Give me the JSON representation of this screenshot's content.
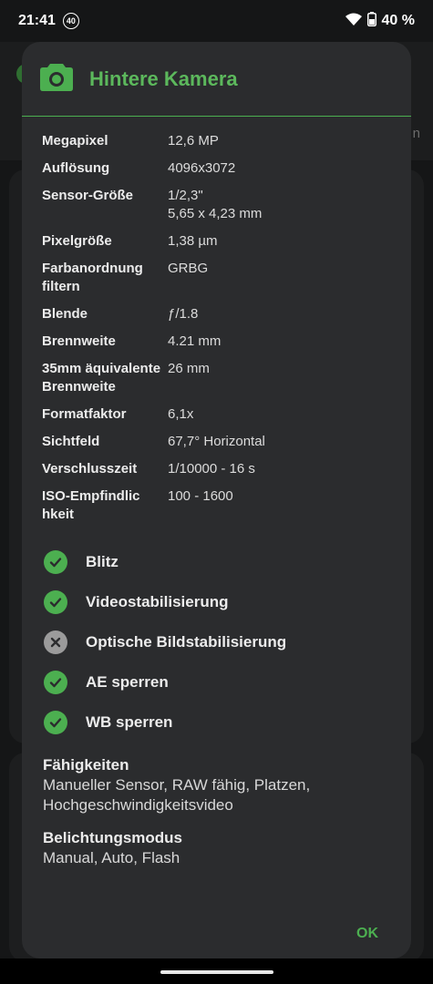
{
  "status_bar": {
    "time": "21:41",
    "notification_badge": "40",
    "battery": "40 %"
  },
  "background": {
    "tab_text": "n"
  },
  "dialog": {
    "title": "Hintere Kamera",
    "icon": "camera-icon",
    "specs": [
      {
        "label": "Megapixel",
        "value": "12,6 MP"
      },
      {
        "label": "Auflösung",
        "value": "4096x3072"
      },
      {
        "label": "Sensor-Größe",
        "value": "1/2,3\"\n5,65 x 4,23 mm"
      },
      {
        "label": "Pixelgröße",
        "value": "1,38 µm"
      },
      {
        "label": "Farbanordnung filtern",
        "value": "GRBG"
      },
      {
        "label": "Blende",
        "value": "ƒ/1.8"
      },
      {
        "label": "Brennweite",
        "value": "4.21 mm"
      },
      {
        "label": "35mm äquivalente Brennweite",
        "value": "26 mm"
      },
      {
        "label": "Formatfaktor",
        "value": "6,1x"
      },
      {
        "label": "Sichtfeld",
        "value": "67,7° Horizontal"
      },
      {
        "label": "Verschlusszeit",
        "value": "1/10000 - 16 s"
      },
      {
        "label": "ISO-Empfindlic\nhkeit",
        "value": "100 - 1600"
      }
    ],
    "features": [
      {
        "label": "Blitz",
        "supported": true
      },
      {
        "label": "Videostabilisierung",
        "supported": true
      },
      {
        "label": "Optische Bildstabilisierung",
        "supported": false
      },
      {
        "label": "AE sperren",
        "supported": true
      },
      {
        "label": "WB sperren",
        "supported": true
      }
    ],
    "capabilities": {
      "title": "Fähigkeiten",
      "text": "Manueller Sensor, RAW fähig, Platzen, Hochgeschwindigkeitsvideo"
    },
    "exposure": {
      "title": "Belichtungsmodus",
      "text": "Manual, Auto, Flash"
    },
    "ok_label": "OK"
  },
  "colors": {
    "accent": "#4caf50",
    "dialog_bg": "#2b2c2e",
    "unsupported": "#9b9b9b"
  }
}
